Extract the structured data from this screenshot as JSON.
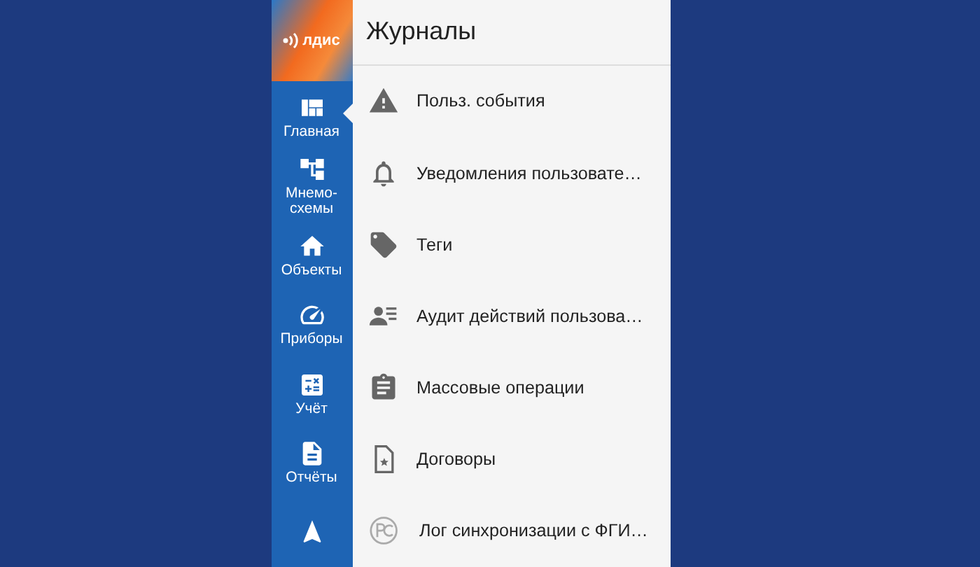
{
  "logo": {
    "text": "лдис"
  },
  "nav": [
    {
      "label": "Главная",
      "kind": "dashboard",
      "selected": true
    },
    {
      "label": "Мнемо-схемы",
      "kind": "tree",
      "selected": false
    },
    {
      "label": "Объекты",
      "kind": "home",
      "selected": false
    },
    {
      "label": "Приборы",
      "kind": "gauge",
      "selected": false
    },
    {
      "label": "Учёт",
      "kind": "calc",
      "selected": false
    },
    {
      "label": "Отчёты",
      "kind": "doc",
      "selected": false
    },
    {
      "kind": "more",
      "selected": false
    }
  ],
  "panel": {
    "title": "Журналы",
    "items": [
      {
        "label": "Польз. события",
        "kind": "warning"
      },
      {
        "label": "Уведомления пользовате…",
        "kind": "bell"
      },
      {
        "label": "Теги",
        "kind": "tag"
      },
      {
        "label": "Аудит действий пользова…",
        "kind": "audit"
      },
      {
        "label": "Массовые операции",
        "kind": "clipboard"
      },
      {
        "label": "Договоры",
        "kind": "contract"
      },
      {
        "label": "Лог синхронизации с ФГИ…",
        "kind": "sync"
      }
    ]
  }
}
